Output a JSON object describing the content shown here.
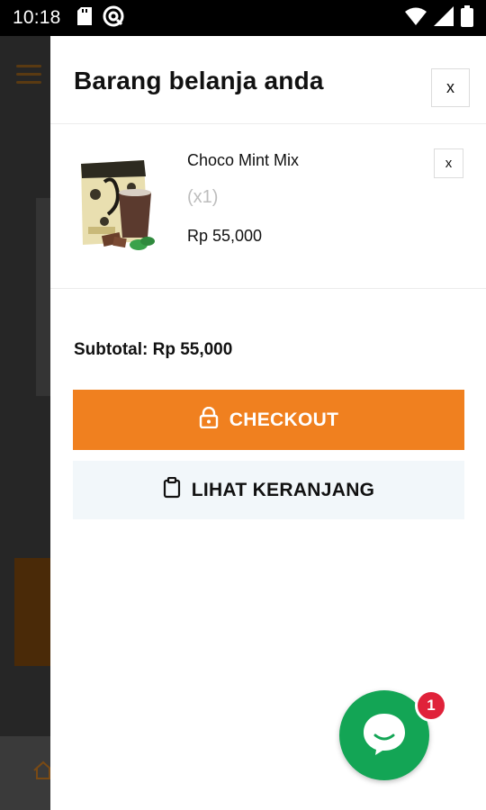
{
  "status_bar": {
    "time": "10:18",
    "icons": [
      "sd-card-icon",
      "at-sign-icon",
      "wifi-icon",
      "signal-icon",
      "battery-icon"
    ]
  },
  "drawer": {
    "title": "Barang belanja anda",
    "close_label": "x"
  },
  "cart": {
    "items": [
      {
        "name": "Choco Mint Mix",
        "quantity": "(x1)",
        "price": "Rp 55,000",
        "remove_label": "x",
        "thumbnail": "choco-mint-product-image"
      }
    ],
    "subtotal": "Subtotal: Rp 55,000"
  },
  "actions": {
    "checkout_label": "CHECKOUT",
    "view_cart_label": "LIHAT KERANJANG"
  },
  "chat": {
    "badge_count": "1"
  },
  "colors": {
    "checkout": "#f0801f",
    "view_cart_bg": "#f2f7fa",
    "chat": "#13a555",
    "badge": "#e0223a"
  }
}
